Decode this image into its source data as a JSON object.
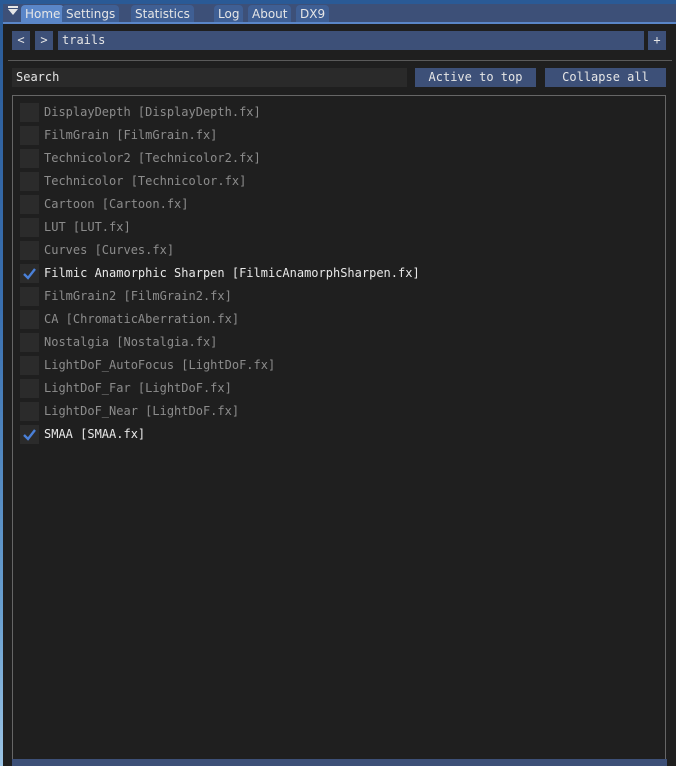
{
  "tabs": [
    {
      "label": "Home",
      "active": true
    },
    {
      "label": "Settings"
    },
    {
      "label": "Statistics"
    },
    {
      "label": "Log"
    },
    {
      "label": "About"
    },
    {
      "label": "DX9"
    }
  ],
  "nav": {
    "prev_label": "<",
    "next_label": ">",
    "preset_value": "trails",
    "add_label": "+"
  },
  "search": {
    "placeholder": "Search"
  },
  "buttons": {
    "active_to_top": "Active to top",
    "collapse_all": "Collapse all"
  },
  "colors": {
    "accent": "#5a86c8",
    "button": "#3d5078",
    "check": "#4a80d8"
  },
  "effects": [
    {
      "label": "DisplayDepth [DisplayDepth.fx]",
      "enabled": false
    },
    {
      "label": "FilmGrain [FilmGrain.fx]",
      "enabled": false
    },
    {
      "label": "Technicolor2 [Technicolor2.fx]",
      "enabled": false
    },
    {
      "label": "Technicolor [Technicolor.fx]",
      "enabled": false
    },
    {
      "label": "Cartoon [Cartoon.fx]",
      "enabled": false
    },
    {
      "label": "LUT [LUT.fx]",
      "enabled": false
    },
    {
      "label": "Curves [Curves.fx]",
      "enabled": false
    },
    {
      "label": "Filmic Anamorphic Sharpen [FilmicAnamorphSharpen.fx]",
      "enabled": true
    },
    {
      "label": "FilmGrain2 [FilmGrain2.fx]",
      "enabled": false
    },
    {
      "label": "CA [ChromaticAberration.fx]",
      "enabled": false
    },
    {
      "label": "Nostalgia [Nostalgia.fx]",
      "enabled": false
    },
    {
      "label": "LightDoF_AutoFocus [LightDoF.fx]",
      "enabled": false
    },
    {
      "label": "LightDoF_Far [LightDoF.fx]",
      "enabled": false
    },
    {
      "label": "LightDoF_Near [LightDoF.fx]",
      "enabled": false
    },
    {
      "label": "SMAA [SMAA.fx]",
      "enabled": true
    }
  ]
}
